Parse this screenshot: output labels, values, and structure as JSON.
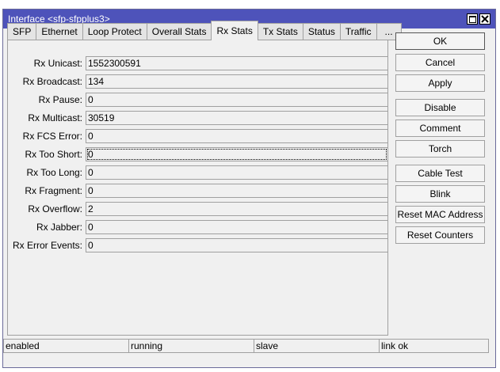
{
  "window": {
    "title": "Interface <sfp-sfpplus3>"
  },
  "tabs": [
    {
      "label": "SFP"
    },
    {
      "label": "Ethernet"
    },
    {
      "label": "Loop Protect"
    },
    {
      "label": "Overall Stats"
    },
    {
      "label": "Rx Stats",
      "active": true
    },
    {
      "label": "Tx Stats"
    },
    {
      "label": "Status"
    },
    {
      "label": "Traffic"
    },
    {
      "label": "..."
    }
  ],
  "fields": [
    {
      "label": "Rx Unicast:",
      "value": "1552300591"
    },
    {
      "label": "Rx Broadcast:",
      "value": "134"
    },
    {
      "label": "Rx Pause:",
      "value": "0"
    },
    {
      "label": "Rx Multicast:",
      "value": "30519"
    },
    {
      "label": "Rx FCS Error:",
      "value": "0"
    },
    {
      "label": "Rx Too Short:",
      "value": "0"
    },
    {
      "label": "Rx Too Long:",
      "value": "0"
    },
    {
      "label": "Rx Fragment:",
      "value": "0"
    },
    {
      "label": "Rx Overflow:",
      "value": "2"
    },
    {
      "label": "Rx Jabber:",
      "value": "0"
    },
    {
      "label": "Rx Error Events:",
      "value": "0"
    }
  ],
  "buttons": [
    {
      "label": "OK"
    },
    {
      "label": "Cancel"
    },
    {
      "label": "Apply"
    },
    {
      "label": "Disable"
    },
    {
      "label": "Comment"
    },
    {
      "label": "Torch"
    },
    {
      "label": "Cable Test"
    },
    {
      "label": "Blink"
    },
    {
      "label": "Reset MAC Address"
    },
    {
      "label": "Reset Counters"
    }
  ],
  "status": [
    "enabled",
    "running",
    "slave",
    "link ok"
  ]
}
